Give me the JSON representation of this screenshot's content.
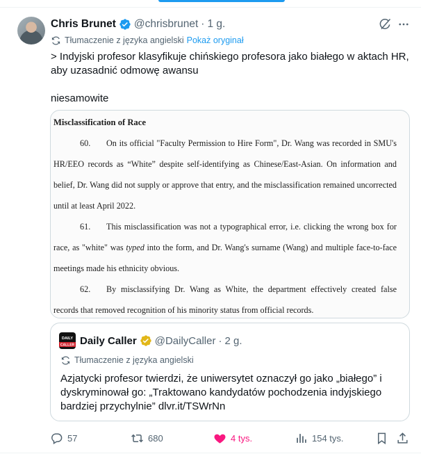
{
  "author": {
    "name": "Chris Brunet",
    "handle": "@chrisbrunet",
    "time": "1 g.",
    "dot": "·"
  },
  "translation": {
    "label": "Tłumaczenie z języka angielski",
    "show_original": "Pokaż oryginał"
  },
  "tweet": {
    "line1": "> Indyjski profesor klasyfikuje chińskiego profesora jako białego w aktach HR, aby uzasadnić odmowę awansu",
    "line2": "niesamowite"
  },
  "document": {
    "heading": "Misclassification of Race",
    "paragraphs": [
      {
        "num": "60.",
        "text": "On its official \"Faculty Permission to Hire Form\", Dr. Wang was recorded in SMU's HR/EEO records as “White” despite self-identifying as Chinese/East-Asian. On information and belief, Dr. Wang did not supply or approve that entry, and the misclassification remained uncorrected until at least April 2022."
      },
      {
        "num": "61.",
        "text_before": "This misclassification was not a typographical error, i.e. clicking the wrong box for race, as \"white\" was ",
        "text_italic": "typed",
        "text_after": " into the form, and Dr. Wang's surname (Wang) and multiple face-to-face meetings made his ethnicity obvious."
      },
      {
        "num": "62.",
        "text": "By misclassifying Dr. Wang as White, the department effectively created false records that removed recognition of his minority status from official records."
      }
    ]
  },
  "quote": {
    "name": "Daily Caller",
    "handle": "@DailyCaller",
    "dot": "·",
    "time": "2 g.",
    "avatar_text": "DAILY CALLER",
    "translation_label": "Tłumaczenie z języka angielski",
    "text": "Azjatycki profesor twierdzi, że uniwersytet oznaczył go jako „białego” i dyskryminował go: „Traktowano kandydatów pochodzenia indyjskiego bardziej przychylnie” dlvr.it/TSWrNn"
  },
  "actions": {
    "replies": "57",
    "reposts": "680",
    "likes": "4 tys.",
    "views": "154 tys."
  },
  "colors": {
    "accent": "#1d9bf0",
    "like": "#f91880",
    "muted": "#536471",
    "gold": "#e2b719"
  }
}
